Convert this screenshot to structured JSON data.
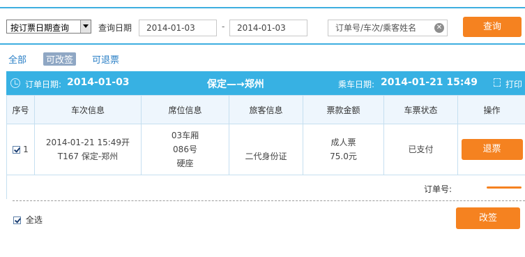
{
  "search": {
    "query_type": "按订票日期查询",
    "date_label": "查询日期",
    "start_date": "2014-01-03",
    "separator": "-",
    "end_date": "2014-01-03",
    "keyword_placeholder": "订单号/车次/乘客姓名",
    "query_button": "查询"
  },
  "filters": {
    "all": "全部",
    "changeable": "可改签",
    "refundable": "可退票",
    "active": "可改签"
  },
  "order": {
    "order_date_label": "订单日期:",
    "order_date": "2014-01-03",
    "route": "保定—→郑州",
    "departure_label": "乘车日期:",
    "departure": "2014-01-21 15:49",
    "print_label": "打印"
  },
  "table": {
    "headers": [
      "序号",
      "车次信息",
      "席位信息",
      "旅客信息",
      "票款金额",
      "车票状态",
      "操作"
    ],
    "rows": [
      {
        "checked": true,
        "index": "1",
        "train_line1": "2014-01-21 15:49开",
        "train_line2": "T167 保定-郑州",
        "seat_line1": "03车厢",
        "seat_line2": "086号",
        "seat_line3": "硬座",
        "passenger": "二代身份证",
        "fare_type": "成人票",
        "fare_amount": "75.0元",
        "status": "已支付",
        "action": "退票"
      }
    ]
  },
  "footer": {
    "order_no_label": "订单号:",
    "select_all": "全选",
    "select_all_checked": true,
    "change_button": "改签"
  },
  "colors": {
    "accent_blue": "#37b1e3",
    "button_orange": "#f58220",
    "link_blue": "#2a7fc6"
  }
}
